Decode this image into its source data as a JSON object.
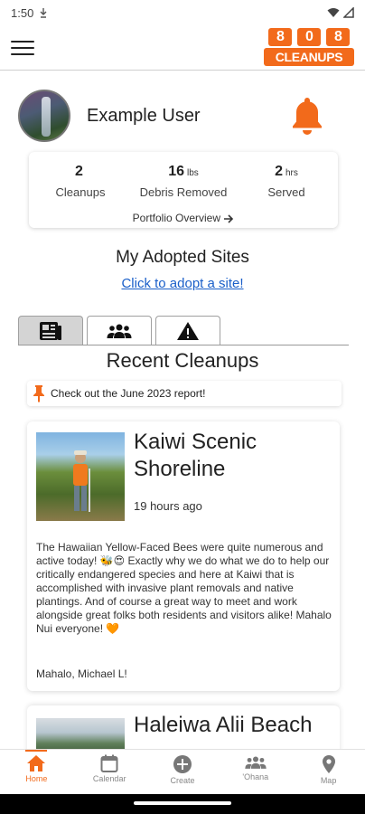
{
  "status_bar": {
    "time": "1:50"
  },
  "logo": {
    "digits": [
      "808",
      ""
    ],
    "word": "CLEANUPS",
    "nums": [
      "8",
      "0",
      "8"
    ]
  },
  "profile": {
    "name": "Example User"
  },
  "stats": [
    {
      "value": "2",
      "unit": "",
      "label": "Cleanups"
    },
    {
      "value": "16",
      "unit": "lbs",
      "label": "Debris Removed"
    },
    {
      "value": "2",
      "unit": "hrs",
      "label": "Served"
    }
  ],
  "portfolio_link": "Portfolio Overview",
  "adopted": {
    "title": "My Adopted Sites",
    "link": "Click to adopt a site!"
  },
  "recent": {
    "title": "Recent Cleanups"
  },
  "report_banner": "Check out the June 2023 report!",
  "cleanups": [
    {
      "title": "Kaiwi Scenic Shoreline",
      "time": "19 hours ago",
      "body": "The Hawaiian Yellow-Faced Bees were quite numerous and active today! 🐝😍 Exactly why we do what we do to help our critically endangered species and here at Kaiwi that is accomplished with invasive plant removals and native plantings. And of course a great way to meet and work alongside great folks both residents and visitors alike! Mahalo Nui everyone! 🧡",
      "signature": "Mahalo, Michael L!"
    },
    {
      "title": "Haleiwa Alii Beach"
    }
  ],
  "nav": [
    {
      "label": "Home",
      "icon": "home-icon",
      "active": true
    },
    {
      "label": "Calendar",
      "icon": "calendar-icon",
      "active": false
    },
    {
      "label": "Create",
      "icon": "plus-circle-icon",
      "active": false
    },
    {
      "label": "'Ohana",
      "icon": "people-icon",
      "active": false
    },
    {
      "label": "Map",
      "icon": "map-pin-icon",
      "active": false
    }
  ],
  "colors": {
    "accent": "#f26a1b",
    "link": "#1a5fc9"
  }
}
